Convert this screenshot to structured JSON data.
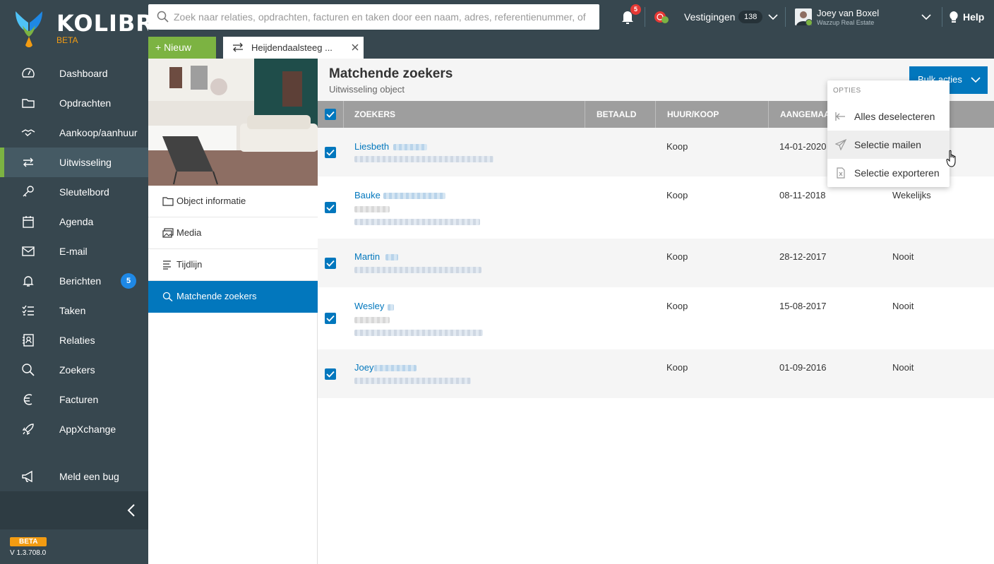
{
  "app": {
    "brand": "KOLIBRI",
    "beta": "BETA",
    "beta_tag": "BETA",
    "version": "V 1.3.708.0"
  },
  "sidebar": {
    "items": [
      {
        "label": "Dashboard",
        "icon": "gauge-icon"
      },
      {
        "label": "Opdrachten",
        "icon": "folder-icon"
      },
      {
        "label": "Aankoop/aanhuur",
        "icon": "handshake-icon"
      },
      {
        "label": "Uitwisseling",
        "icon": "exchange-icon",
        "active": true
      },
      {
        "label": "Sleutelbord",
        "icon": "key-icon"
      },
      {
        "label": "Agenda",
        "icon": "calendar-icon"
      },
      {
        "label": "E-mail",
        "icon": "mail-icon"
      },
      {
        "label": "Berichten",
        "icon": "bell-icon",
        "badge": "5"
      },
      {
        "label": "Taken",
        "icon": "tasks-icon"
      },
      {
        "label": "Relaties",
        "icon": "contacts-icon"
      },
      {
        "label": "Zoekers",
        "icon": "search-icon"
      },
      {
        "label": "Facturen",
        "icon": "euro-icon"
      },
      {
        "label": "AppXchange",
        "icon": "rocket-icon"
      }
    ],
    "bug": "Meld een bug"
  },
  "topbar": {
    "search_placeholder": "Zoek naar relaties, opdrachten, facturen en taken door een naam, adres, referentienummer, of",
    "notifications": "5",
    "vestigingen_label": "Vestigingen",
    "vestigingen_count": "138",
    "user_name": "Joey van Boxel",
    "user_company": "Wazzup Real Estate",
    "help": "Help"
  },
  "tabbar": {
    "new_label": "+ Nieuw",
    "tab_label": "Heijdendaalsteeg ..."
  },
  "detail_menu": [
    {
      "label": "Object informatie",
      "icon": "folder-icon"
    },
    {
      "label": "Media",
      "icon": "images-icon"
    },
    {
      "label": "Tijdlijn",
      "icon": "list-icon"
    },
    {
      "label": "Matchende zoekers",
      "icon": "search-icon",
      "active": true
    }
  ],
  "main": {
    "title": "Matchende zoekers",
    "subtitle": "Uitwisseling object",
    "bulk_label": "Bulk acties",
    "columns": [
      "ZOEKERS",
      "BETAALD",
      "HUUR/KOOP",
      "AANGEMAA"
    ],
    "rows": [
      {
        "name": "Liesbeth",
        "type": "Koop",
        "date": "14-01-2020",
        "freq": ""
      },
      {
        "name": "Bauke",
        "type": "Koop",
        "date": "08-11-2018",
        "freq": "Wekelijks"
      },
      {
        "name": "Martin",
        "type": "Koop",
        "date": "28-12-2017",
        "freq": "Nooit"
      },
      {
        "name": "Wesley",
        "type": "Koop",
        "date": "15-08-2017",
        "freq": "Nooit"
      },
      {
        "name": "Joey",
        "type": "Koop",
        "date": "01-09-2016",
        "freq": "Nooit"
      }
    ]
  },
  "dropdown": {
    "header": "OPTIES",
    "items": [
      {
        "label": "Alles deselecteren",
        "icon": "deselect-icon"
      },
      {
        "label": "Selectie mailen",
        "icon": "send-icon"
      },
      {
        "label": "Selectie exporteren",
        "icon": "excel-file-icon"
      }
    ]
  },
  "colors": {
    "sidebar": "#37474f",
    "accent": "#0277bd",
    "green": "#7cb342",
    "badge_red": "#e53935"
  }
}
